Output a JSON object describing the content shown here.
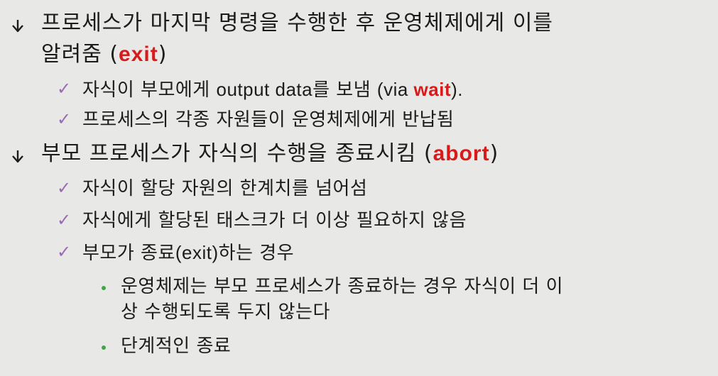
{
  "items": [
    {
      "line1": "프로세스가 마지막 명령을 수행한 후 운영체제에게 이를",
      "line2_pre": "알려줌 (",
      "line2_kw": "exit",
      "line2_post": ")",
      "subitems": [
        {
          "pre": "자식이 부모에게 ",
          "latin": "output data",
          "mid": "를 보냄 ",
          "latin2": "(via ",
          "kw": "wait",
          "post": ")."
        },
        {
          "text": "프로세스의 각종 자원들이 운영체제에게 반납됨"
        }
      ]
    },
    {
      "pre": "부모 프로세스가 자식의 수행을 종료시킴 (",
      "kw": "abort",
      "post": ")",
      "subitems": [
        {
          "text": "자식이 할당 자원의 한계치를 넘어섬"
        },
        {
          "text": "자식에게 할당된 태스크가 더 이상 필요하지 않음"
        },
        {
          "pre": "부모가 종료",
          "latin": "(exit)",
          "post": "하는 경우",
          "subsubitems": [
            {
              "line1": "운영체제는 부모 프로세스가 종료하는 경우 자식이 더 이",
              "line2": "상 수행되도록 두지 않는다"
            },
            {
              "text": "단계적인 종료"
            }
          ]
        }
      ]
    }
  ],
  "colors": {
    "background": "#e8e8e6",
    "text": "#1c1c1c",
    "keyword": "#d91a1a",
    "check": "#9a6ab3",
    "dot": "#3fa64a"
  },
  "icons": {
    "level1": "arrow-bullet-icon",
    "level2": "check-mark-icon",
    "level3": "dot-bullet-icon"
  }
}
